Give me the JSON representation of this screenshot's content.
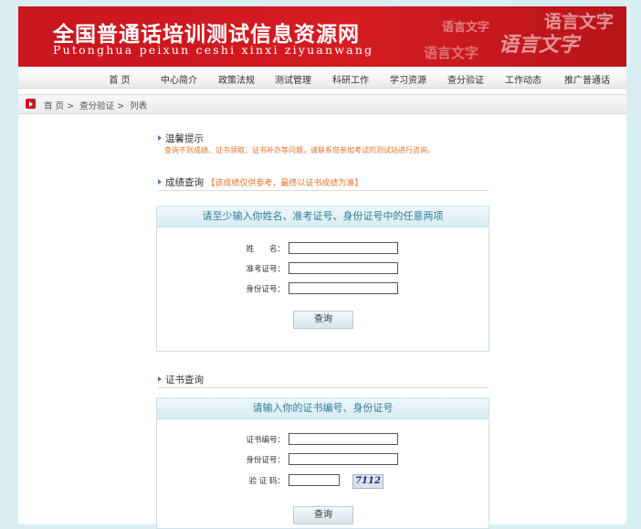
{
  "banner": {
    "title": "全国普通话培训测试信息资源网",
    "subtitle": "Putonghua peixun ceshi xinxi ziyuanwang",
    "deco_1": "语言文字",
    "deco_2": "语言文字",
    "deco_3": "语言文字",
    "deco_4": "语言文字"
  },
  "nav": {
    "items": [
      "首 页",
      "中心简介",
      "政策法规",
      "测试管理",
      "科研工作",
      "学习资源",
      "查分验证",
      "工作动态",
      "推广普通话"
    ]
  },
  "breadcrumb": {
    "home": "首 页",
    "sep1": ">",
    "level1": "查分验证",
    "sep2": ">",
    "current": "列表"
  },
  "tip": {
    "title": "温馨提示",
    "text": "查询不到成绩、证书领取、证书补办等问题，请联系您参加考试的测试站进行咨询。"
  },
  "score_query": {
    "title": "成绩查询",
    "note": "【该成绩仅供参考，最终以证书成绩为准】",
    "panel_title": "请至少输入你姓名、准考证号、身份证号中的任意两项",
    "fields": [
      {
        "label": "姓　　名：",
        "value": ""
      },
      {
        "label": "准考证号：",
        "value": ""
      },
      {
        "label": "身份证号：",
        "value": ""
      }
    ],
    "button": "查询"
  },
  "cert_query": {
    "title": "证书查询",
    "panel_title": "请输入你的证书编号、身份证号",
    "fields": [
      {
        "label": "证书编号：",
        "value": ""
      },
      {
        "label": "身份证号：",
        "value": ""
      }
    ],
    "captcha_label": "验 证 码：",
    "captcha_value": "",
    "captcha_image": "7112",
    "button": "查询"
  },
  "colors": {
    "banner_red": "#c9151d",
    "panel_title_teal": "#2e7a99",
    "note_orange": "#e0742a"
  }
}
